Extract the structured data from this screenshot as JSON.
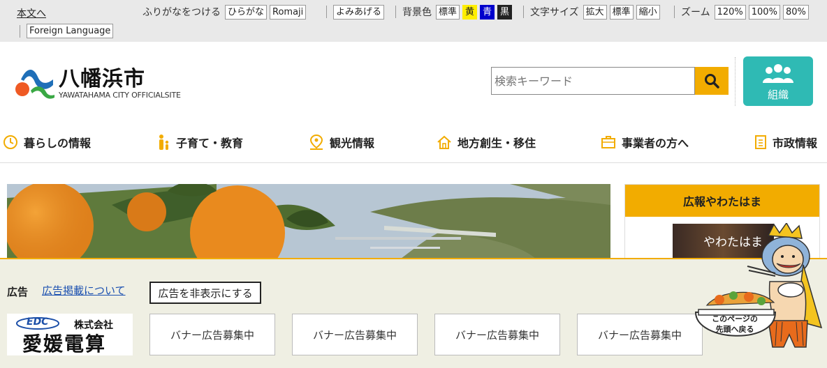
{
  "a11y": {
    "skip": "本文へ",
    "furigana_label": "ふりがなをつける",
    "hiragana": "ひらがな",
    "romaji": "Romaji",
    "read_aloud": "よみあげる",
    "bg_label": "背景色",
    "bg_standard": "標準",
    "bg_yellow": "黄",
    "bg_blue": "青",
    "bg_black": "黒",
    "text_size_label": "文字サイズ",
    "text_bigger": "拡大",
    "text_standard": "標準",
    "text_smaller": "縮小",
    "zoom_label": "ズーム",
    "zoom_120": "120%",
    "zoom_100": "100%",
    "zoom_80": "80%",
    "foreign": "Foreign Language"
  },
  "header": {
    "title": "八幡浜市",
    "subtitle": "YAWATAHAMA CITY OFFICIALSITE",
    "search_placeholder": "検索キーワード",
    "org_label": "組織"
  },
  "nav": [
    {
      "label": "暮らしの情報",
      "icon": "clock-icon"
    },
    {
      "label": "子育て・教育",
      "icon": "parent-child-icon"
    },
    {
      "label": "観光情報",
      "icon": "map-pin-icon"
    },
    {
      "label": "地方創生・移住",
      "icon": "house-icon"
    },
    {
      "label": "事業者の方へ",
      "icon": "briefcase-icon"
    },
    {
      "label": "市政情報",
      "icon": "document-icon"
    }
  ],
  "side": {
    "heading": "広報やわたはま",
    "thumb_text": "やわたはま"
  },
  "ads": {
    "label": "広告",
    "about_link": "広告掲載について",
    "hide_button": "広告を非表示にする",
    "sponsor_small": "株式会社",
    "sponsor_name": "愛媛電算",
    "sponsor_logo": "EDC",
    "banners": [
      "バナー広告募集中",
      "バナー広告募集中",
      "バナー広告募集中",
      "バナー広告募集中"
    ]
  },
  "totop": {
    "line1": "このページの",
    "line2": "先頭へ戻る"
  },
  "colors": {
    "accent": "#f2ac00",
    "teal": "#2fbab4"
  }
}
